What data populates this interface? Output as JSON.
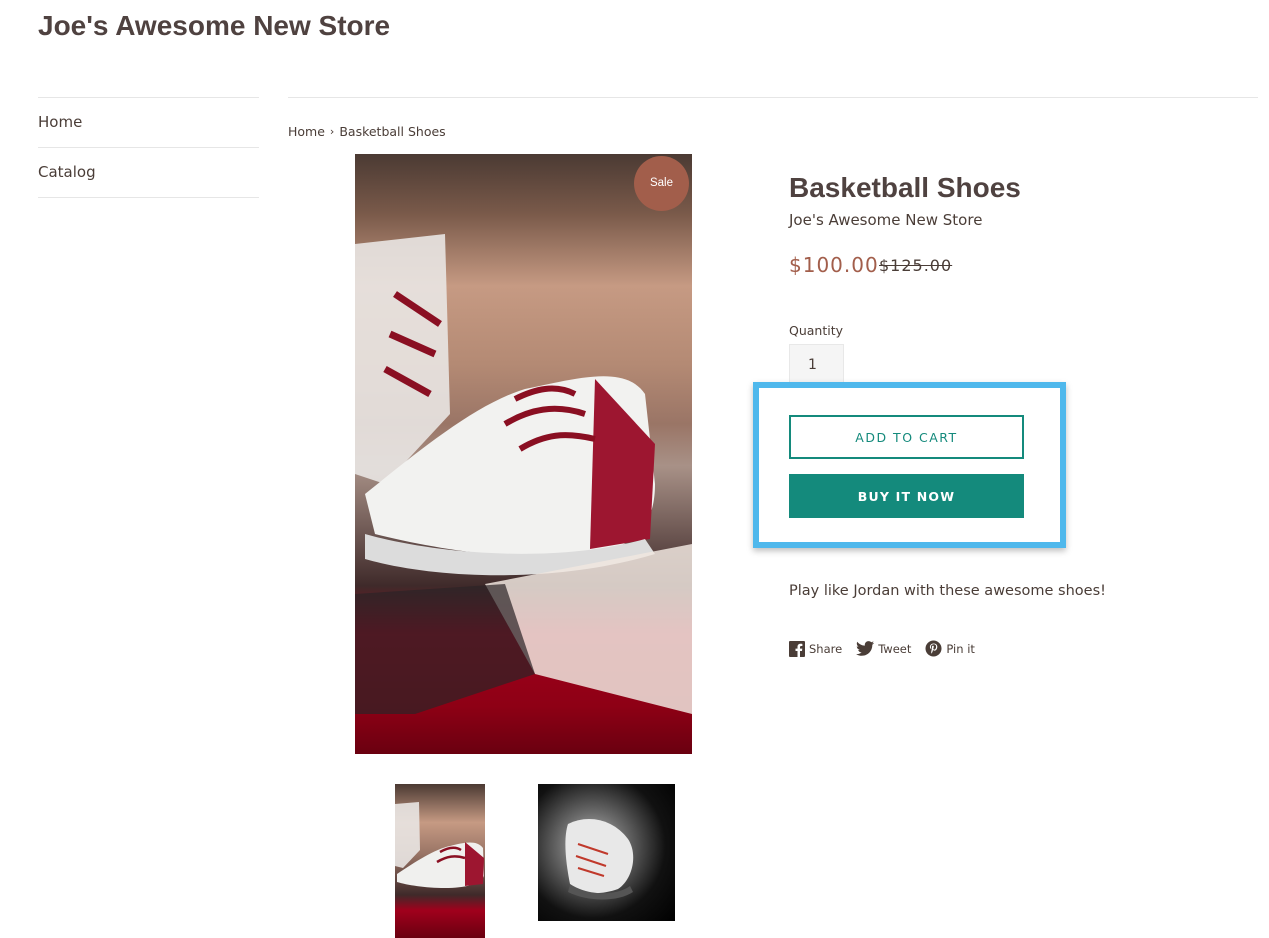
{
  "store": {
    "name": "Joe's Awesome New Store"
  },
  "sidebar": {
    "items": [
      {
        "label": "Home"
      },
      {
        "label": "Catalog"
      }
    ]
  },
  "breadcrumb": {
    "home": "Home",
    "separator": "›",
    "current": "Basketball Shoes"
  },
  "product": {
    "badge": "Sale",
    "title": "Basketball Shoes",
    "vendor": "Joe's Awesome New Store",
    "price": "$100.00",
    "compare_price": "$125.00",
    "quantity_label": "Quantity",
    "quantity_value": "1",
    "add_to_cart_label": "ADD TO CART",
    "buy_now_label": "BUY IT NOW",
    "description": "Play like Jordan with these awesome shoes!"
  },
  "social": {
    "share_label": "Share",
    "tweet_label": "Tweet",
    "pin_label": "Pin it"
  },
  "colors": {
    "accent": "#148a7c",
    "sale": "#a25e4b",
    "highlight": "#4fb8ec",
    "text": "#4a3d37"
  }
}
